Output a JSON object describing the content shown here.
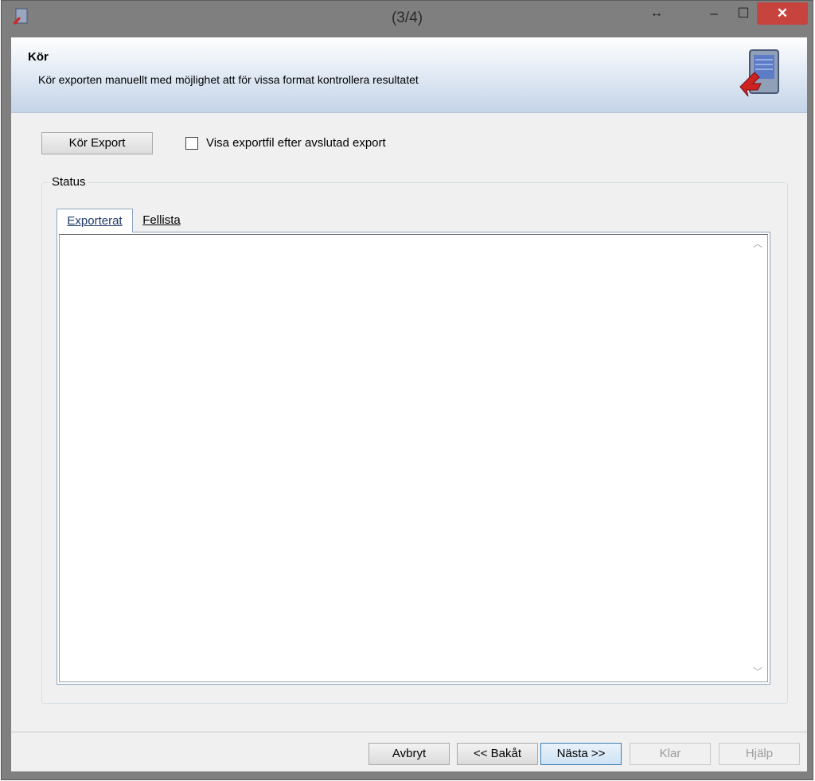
{
  "window": {
    "title": "(3/4)",
    "resize_glyph": "↔",
    "minimize_glyph": "–",
    "maximize_glyph": "☐",
    "close_glyph": "✕"
  },
  "header": {
    "title": "Kör",
    "description": "Kör exporten manuellt med möjlighet att för vissa format kontrollera resultatet"
  },
  "controls": {
    "run_export_label": "Kör Export",
    "show_file_label": "Visa exportfil efter avslutad export",
    "show_file_checked": false
  },
  "status": {
    "legend": "Status",
    "tabs": [
      {
        "label": "Exporterat",
        "active": true
      },
      {
        "label": "Fellista",
        "active": false
      }
    ]
  },
  "footer": {
    "cancel": "Avbryt",
    "back": "<< Bakåt",
    "next": "Nästa >>",
    "finish": "Klar",
    "help": "Hjälp"
  },
  "colors": {
    "close_button": "#c7433d",
    "titlebar": "#7f7f7f",
    "header_gradient_end": "#c4d4e8"
  }
}
